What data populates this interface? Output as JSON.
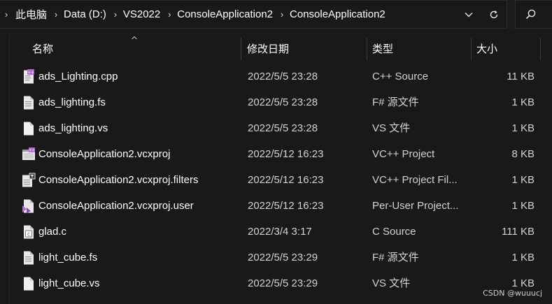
{
  "address_bar": {
    "crumbs": [
      "此电脑",
      "Data (D:)",
      "VS2022",
      "ConsoleApplication2",
      "ConsoleApplication2"
    ],
    "icons": [
      "chevron-right-icon",
      "chevron-down-icon",
      "refresh-icon",
      "search-icon"
    ]
  },
  "columns": {
    "name": "名称",
    "modified": "修改日期",
    "type": "类型",
    "size": "大小"
  },
  "files": [
    {
      "name": "ads_Lighting.cpp",
      "modified": "2022/5/5 23:28",
      "type": "C++ Source",
      "size": "11 KB",
      "icon": "cpp-file-icon"
    },
    {
      "name": "ads_lighting.fs",
      "modified": "2022/5/5 23:28",
      "type": "F# 源文件",
      "size": "1 KB",
      "icon": "text-file-icon"
    },
    {
      "name": "ads_lighting.vs",
      "modified": "2022/5/5 23:28",
      "type": "VS 文件",
      "size": "1 KB",
      "icon": "blank-file-icon"
    },
    {
      "name": "ConsoleApplication2.vcxproj",
      "modified": "2022/5/12 16:23",
      "type": "VC++ Project",
      "size": "8 KB",
      "icon": "vcxproj-file-icon"
    },
    {
      "name": "ConsoleApplication2.vcxproj.filters",
      "modified": "2022/5/12 16:23",
      "type": "VC++ Project Fil...",
      "size": "1 KB",
      "icon": "filters-file-icon"
    },
    {
      "name": "ConsoleApplication2.vcxproj.user",
      "modified": "2022/5/12 16:23",
      "type": "Per-User Project...",
      "size": "1 KB",
      "icon": "user-file-icon"
    },
    {
      "name": "glad.c",
      "modified": "2022/3/4 3:17",
      "type": "C Source",
      "size": "111 KB",
      "icon": "c-file-icon"
    },
    {
      "name": "light_cube.fs",
      "modified": "2022/5/5 23:29",
      "type": "F# 源文件",
      "size": "1 KB",
      "icon": "text-file-icon"
    },
    {
      "name": "light_cube.vs",
      "modified": "2022/5/5 23:29",
      "type": "VS 文件",
      "size": "1 KB",
      "icon": "blank-file-icon"
    }
  ],
  "watermark": "CSDN @wuuucj",
  "colors": {
    "background": "#191919",
    "text": "#ffffff",
    "secondary_text": "#d2d2d2",
    "accent_purple": "#b36cd8"
  }
}
